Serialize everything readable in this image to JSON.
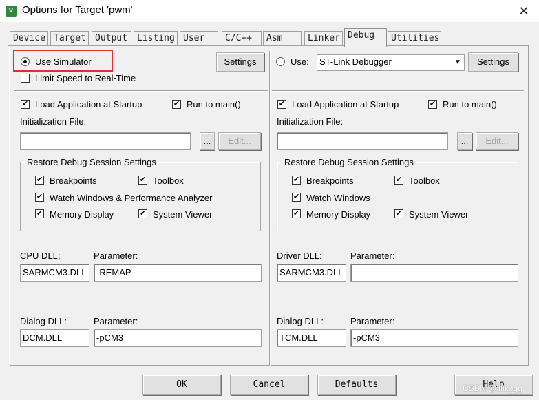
{
  "window": {
    "title": "Options for Target 'pwm'",
    "app_icon": "keil-uvision-icon",
    "close_glyph": "✕"
  },
  "tabs": [
    {
      "label": "Device"
    },
    {
      "label": "Target"
    },
    {
      "label": "Output"
    },
    {
      "label": "Listing"
    },
    {
      "label": "User"
    },
    {
      "label": "C/C++"
    },
    {
      "label": "Asm"
    },
    {
      "label": "Linker"
    },
    {
      "label": "Debug",
      "active": true
    },
    {
      "label": "Utilities"
    }
  ],
  "left": {
    "use_simulator": "Use Simulator",
    "use_simulator_checked": true,
    "settings_button": "Settings",
    "limit_speed": "Limit Speed to Real-Time",
    "limit_speed_checked": false,
    "load_app": "Load Application at Startup",
    "load_app_checked": true,
    "run_to_main": "Run to main()",
    "run_to_main_checked": true,
    "init_file_label": "Initialization File:",
    "init_file_value": "",
    "browse_button": "...",
    "edit_button": "Edit...",
    "restore_group": "Restore Debug Session Settings",
    "breakpoints": "Breakpoints",
    "toolbox": "Toolbox",
    "watch_windows": "Watch Windows & Performance Analyzer",
    "memory_display": "Memory Display",
    "system_viewer": "System Viewer",
    "cpu_dll_label": "CPU DLL:",
    "cpu_dll_value": "SARMCM3.DLL",
    "cpu_param_label": "Parameter:",
    "cpu_param_value": "-REMAP",
    "dialog_dll_label": "Dialog DLL:",
    "dialog_dll_value": "DCM.DLL",
    "dialog_param_label": "Parameter:",
    "dialog_param_value": "-pCM3"
  },
  "right": {
    "use_label": "Use:",
    "use_checked": false,
    "debugger_value": "ST-Link Debugger",
    "settings_button": "Settings",
    "load_app": "Load Application at Startup",
    "load_app_checked": true,
    "run_to_main": "Run to main()",
    "run_to_main_checked": true,
    "init_file_label": "Initialization File:",
    "init_file_value": "",
    "browse_button": "...",
    "edit_button": "Edit...",
    "restore_group": "Restore Debug Session Settings",
    "breakpoints": "Breakpoints",
    "toolbox": "Toolbox",
    "watch_windows": "Watch Windows",
    "memory_display": "Memory Display",
    "system_viewer": "System Viewer",
    "driver_dll_label": "Driver DLL:",
    "driver_dll_value": "SARMCM3.DLL",
    "driver_param_label": "Parameter:",
    "driver_param_value": "",
    "dialog_dll_label": "Dialog DLL:",
    "dialog_dll_value": "TCM.DLL",
    "dialog_param_label": "Parameter:",
    "dialog_param_value": "-pCM3"
  },
  "footer": {
    "ok": "OK",
    "cancel": "Cancel",
    "defaults": "Defaults",
    "help": "Help"
  },
  "watermark": "CSDN @lifik_gg",
  "checkmark_glyph": "✔",
  "colors": {
    "highlight": "#e03030",
    "app_icon": "#2f8a3a"
  }
}
